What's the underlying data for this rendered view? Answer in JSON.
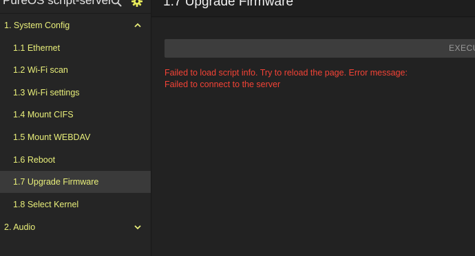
{
  "app": {
    "title": "PureOS script-server"
  },
  "header": {
    "icons": [
      "search-icon",
      "gear-icon"
    ],
    "gear_color": "#e6ea5a"
  },
  "sidebar": {
    "groups": [
      {
        "label": "1. System Config",
        "expanded": true,
        "items": [
          {
            "label": "1.1 Ethernet"
          },
          {
            "label": "1.2 Wi-Fi scan"
          },
          {
            "label": "1.3 Wi-Fi settings"
          },
          {
            "label": "1.4 Mount CIFS"
          },
          {
            "label": "1.5 Mount WEBDAV"
          },
          {
            "label": "1.6 Reboot"
          },
          {
            "label": "1.7 Upgrade Firmware",
            "active": true
          },
          {
            "label": "1.8 Select Kernel"
          }
        ]
      },
      {
        "label": "2. Audio",
        "expanded": false,
        "items": []
      }
    ]
  },
  "main": {
    "title": "1.7 Upgrade Firmware",
    "execute_label": "EXECUTE",
    "error": {
      "line1": "Failed to load script info. Try to reload the page. Error message:",
      "line2": "Failed to connect to the server"
    }
  },
  "colors": {
    "accent": "#e9ef7a",
    "error": "#f44336",
    "background": "#222222",
    "sidebar": "#252525",
    "active_item": "#3a3a3a"
  }
}
